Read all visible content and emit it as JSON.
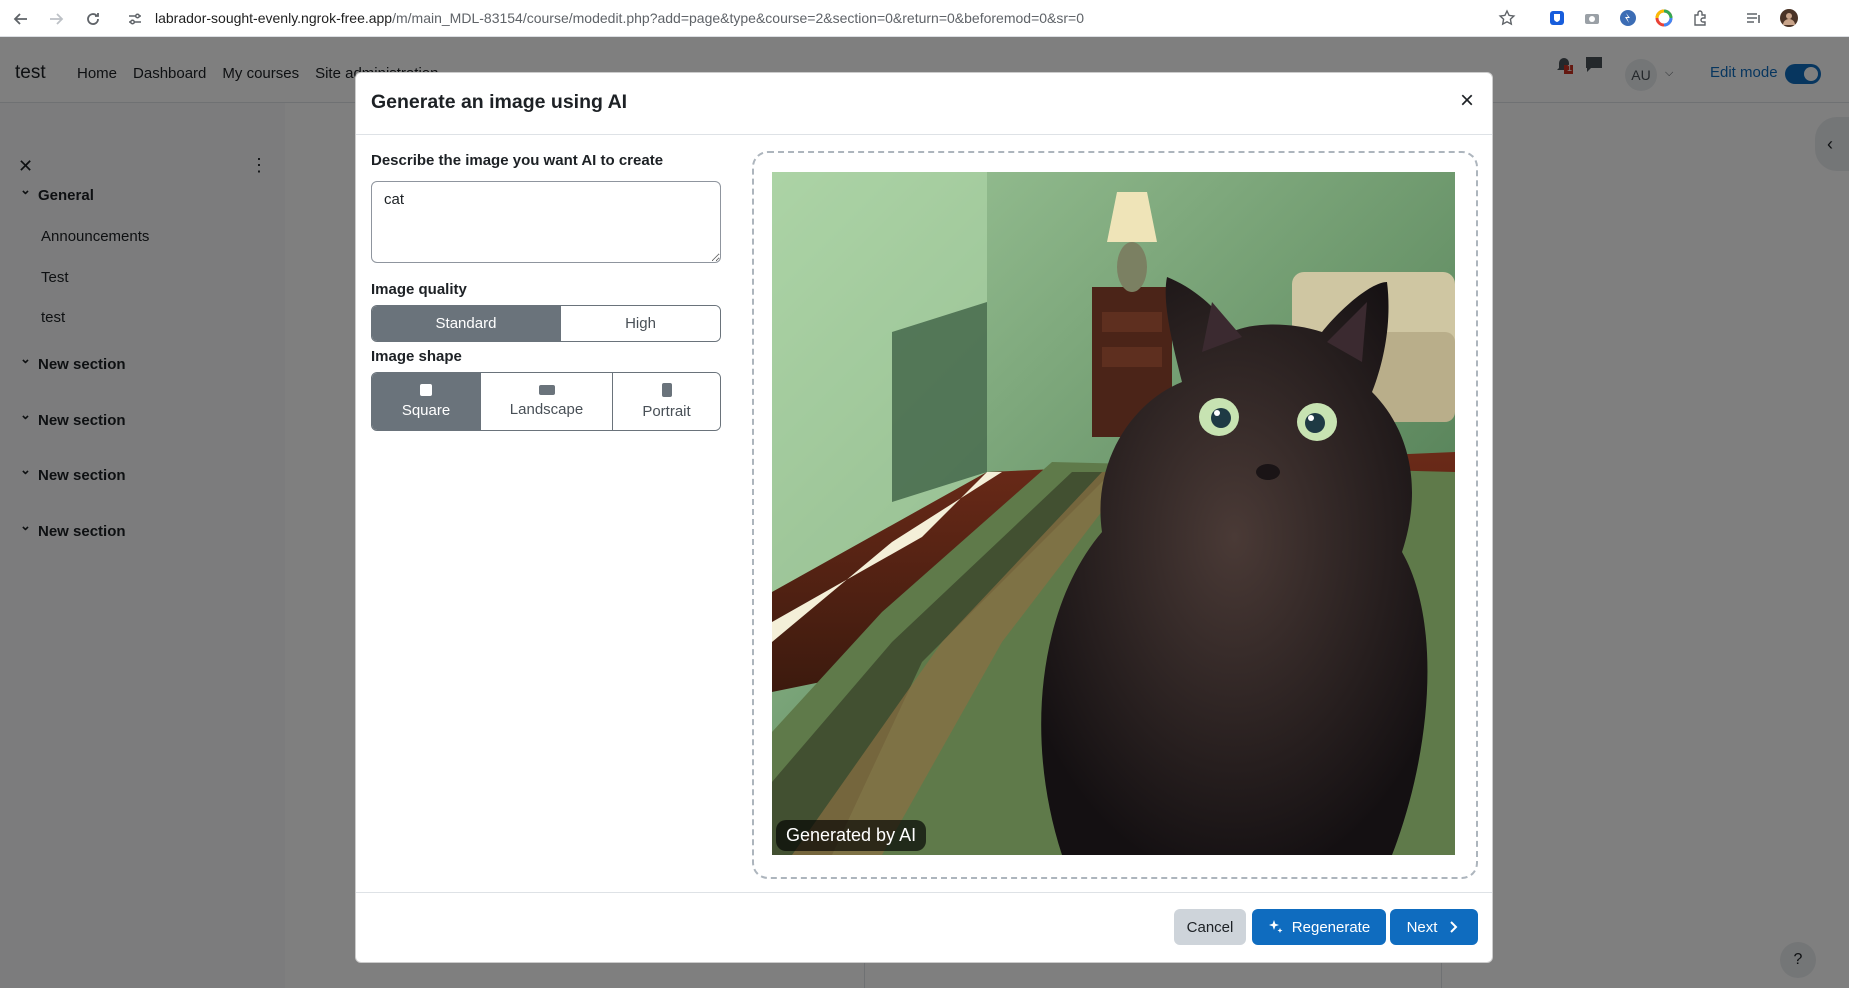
{
  "browser": {
    "url_host": "labrador-sought-evenly.ngrok-free.app",
    "url_path": "/m/main_MDL-83154/course/modedit.php?add=page&type&course=2&section=0&return=0&beforemod=0&sr=0"
  },
  "navbar": {
    "site_name": "test",
    "links": [
      "Home",
      "Dashboard",
      "My courses",
      "Site administration"
    ],
    "avatar_initials": "AU",
    "notification_count": "1",
    "edit_mode_label": "Edit mode"
  },
  "course_index": {
    "items": [
      {
        "label": "General",
        "type": "section"
      },
      {
        "label": "Announcements",
        "type": "activity"
      },
      {
        "label": "Test",
        "type": "activity"
      },
      {
        "label": "test",
        "type": "activity"
      },
      {
        "label": "New section",
        "type": "section"
      },
      {
        "label": "New section",
        "type": "section"
      },
      {
        "label": "New section",
        "type": "section"
      },
      {
        "label": "New section",
        "type": "section"
      }
    ]
  },
  "modal": {
    "title": "Generate an image using AI",
    "prompt_label": "Describe the image you want AI to create",
    "prompt_value": "cat",
    "quality_label": "Image quality",
    "quality_options": [
      "Standard",
      "High"
    ],
    "quality_selected": "Standard",
    "shape_label": "Image shape",
    "shape_options": [
      "Square",
      "Landscape",
      "Portrait"
    ],
    "shape_selected": "Square",
    "badge": "Generated by AI",
    "cancel": "Cancel",
    "regenerate": "Regenerate",
    "next": "Next"
  },
  "colors": {
    "primary": "#0f6cbf",
    "segment_active": "#6a737b"
  }
}
